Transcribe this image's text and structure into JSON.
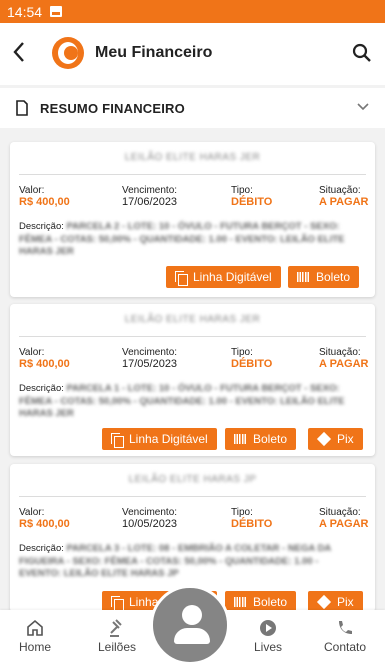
{
  "status_bar": {
    "time": "14:54"
  },
  "header": {
    "title": "Meu Financeiro"
  },
  "section": {
    "title": "RESUMO FINANCEIRO"
  },
  "labels": {
    "valor": "Valor:",
    "vencimento": "Vencimento:",
    "tipo": "Tipo:",
    "situacao": "Situação:",
    "descricao": "Descrição:"
  },
  "buttons": {
    "linha": "Linha Digitável",
    "boleto": "Boleto",
    "pix": "Pix"
  },
  "cards": [
    {
      "title": "LEILÃO ELITE HARAS JER",
      "valor": "R$ 400,00",
      "vencimento": "17/06/2023",
      "tipo": "DÉBITO",
      "situacao": "A PAGAR",
      "descricao": "PARCELA 2 - LOTE: 10 - ÓVULO - FUTURA BERÇOT - SEXO: FÊMEA - COTAS: 50,00% - QUANTIDADE: 1.00 - EVENTO: LEILÃO ELITE HARAS JER"
    },
    {
      "title": "LEILÃO ELITE HARAS JER",
      "valor": "R$ 400,00",
      "vencimento": "17/05/2023",
      "tipo": "DÉBITO",
      "situacao": "A PAGAR",
      "descricao": "PARCELA 1 - LOTE: 10 - ÓVULO - FUTURA BERÇOT - SEXO: FÊMEA - COTAS: 50,00% - QUANTIDADE: 1.00 - EVENTO: LEILÃO ELITE HARAS JER"
    },
    {
      "title": "LEILÃO ELITE HARAS JP",
      "valor": "R$ 400,00",
      "vencimento": "10/05/2023",
      "tipo": "DÉBITO",
      "situacao": "A PAGAR",
      "descricao": "PARCELA 3 - LOTE: 08 - EMBRIÃO A COLETAR - NEGA DA FIGUEIRA - SEXO: FÊMEA - COTAS: 50,00% - QUANTIDADE: 1.00 - EVENTO: LEILÃO ELITE HARAS JP"
    }
  ],
  "nav": {
    "home": "Home",
    "leiloes": "Leilões",
    "lives": "Lives",
    "contato": "Contato"
  },
  "colors": {
    "accent": "#f07418",
    "background": "#f2f2f2"
  }
}
